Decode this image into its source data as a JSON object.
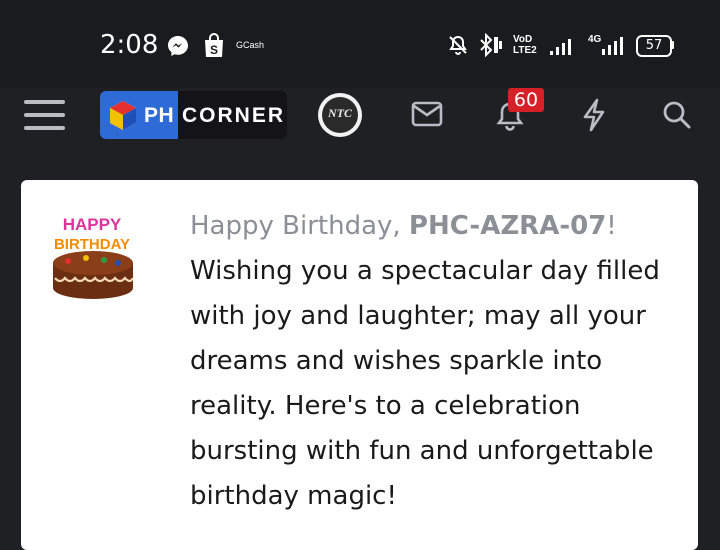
{
  "status_bar": {
    "time": "2:08",
    "gcash_label": "GCash",
    "volte_label_top": "VoD",
    "volte_label_bottom": "LTE2",
    "network_label": "4G",
    "battery_level": "57",
    "icons": [
      "messenger-icon",
      "shopee-icon",
      "mute-bell-icon",
      "bluetooth-icon",
      "signal-icon",
      "battery-icon"
    ]
  },
  "app_bar": {
    "logo_ph": "PH",
    "logo_corner": "CORNER",
    "avatar_label": "NTC",
    "notification_count": "60",
    "icons": [
      "menu-icon",
      "mail-icon",
      "bell-icon",
      "lightning-icon",
      "search-icon"
    ]
  },
  "message": {
    "greeting": "Happy Birthday, ",
    "username": "PHC-AZRA-07",
    "exclaim": "!",
    "body": "Wishing you a spectacular day filled with joy and laughter; may all your dreams and wishes sparkle into reality. Here's to a celebration bursting with fun and unforgettable birthday magic!",
    "cake_text_top": "HAPPY",
    "cake_text_bottom": "BIRTHDAY"
  },
  "colors": {
    "background": "#1f2024",
    "card": "#ffffff",
    "muted_text": "#8b8f96",
    "badge": "#d61f26",
    "logo_blue": "#2f6bd6"
  }
}
